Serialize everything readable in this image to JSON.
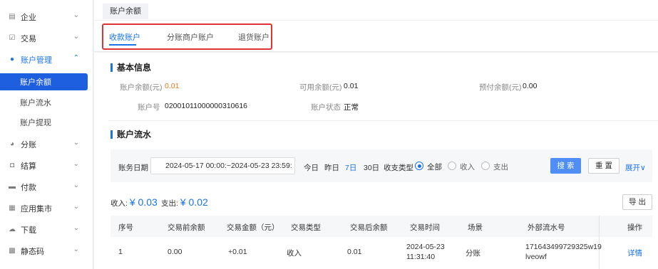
{
  "sidebar": {
    "items": [
      {
        "label": "企业",
        "icon": "building-icon"
      },
      {
        "label": "交易",
        "icon": "checkbox-icon"
      },
      {
        "label": "账户管理",
        "icon": "account-icon"
      },
      {
        "label": "分账",
        "icon": "pie-icon"
      },
      {
        "label": "结算",
        "icon": "settle-icon"
      },
      {
        "label": "付款",
        "icon": "folder-icon"
      },
      {
        "label": "应用集市",
        "icon": "apps-icon"
      },
      {
        "label": "下载",
        "icon": "cloud-icon"
      },
      {
        "label": "静态码",
        "icon": "qr-icon"
      }
    ],
    "sub_items": [
      {
        "label": "账户余额"
      },
      {
        "label": "账户流水"
      },
      {
        "label": "账户提现"
      }
    ]
  },
  "page_tab": "账户余额",
  "account_tabs": [
    "收款账户",
    "分账商户账户",
    "退货账户"
  ],
  "basic_info": {
    "title": "基本信息",
    "balance_label": "账户余额(元)",
    "balance_value": "0.01",
    "available_label": "可用余额(元)",
    "available_value": "0.01",
    "prepaid_label": "预付余额(元)",
    "prepaid_value": "0.00",
    "account_no_label": "账户号",
    "account_no_value": "020010110000003106 16",
    "status_label": "账户状态",
    "status_value": "正常"
  },
  "flow": {
    "title": "账户流水",
    "date_label": "账务日期",
    "date_range": "2024-05-17 00:00:~2024-05-23 23:59:",
    "quick": [
      "今日",
      "昨日",
      "7日",
      "30日"
    ],
    "type_label": "收支类型",
    "types": [
      "全部",
      "收入",
      "支出"
    ],
    "search_label": "搜 索",
    "reset_label": "重 置",
    "expand_label": "展开∨",
    "export_label": "导 出",
    "income_label": "收入:",
    "income_value": "¥ 0.03",
    "expense_label": "支出:",
    "expense_value": "¥ 0.02"
  },
  "table": {
    "headers": [
      "序号",
      "交易前余额",
      "交易金额（元）",
      "交易类型",
      "交易后余额",
      "交易时间",
      "场景",
      "外部流水号",
      "操作"
    ],
    "rows": [
      {
        "no": "1",
        "before": "0.00",
        "amount": "+0.01",
        "type": "收入",
        "after": "0.01",
        "time_date": "2024-05-23",
        "time_clock": "11:31:40",
        "scene": "分账",
        "ext_no_1": "171643499729325w19",
        "ext_no_2": "lveowf",
        "action": "详情"
      }
    ]
  },
  "colors": {
    "accent": "#1a73e8",
    "highlight": "#e03333",
    "orange": "#e87a1a"
  }
}
